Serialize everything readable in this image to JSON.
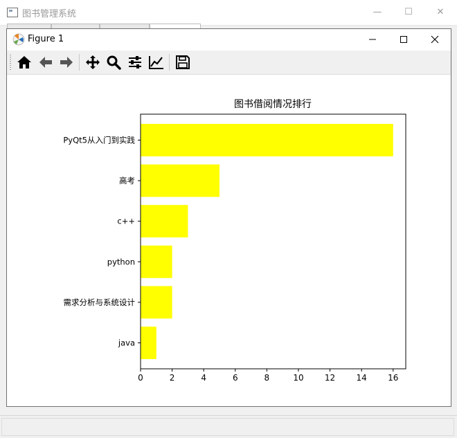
{
  "outer_window": {
    "title": "图书管理系统",
    "minimize_symbol": "—",
    "maximize_symbol": "☐",
    "close_symbol": "✕"
  },
  "figure_window": {
    "title": "Figure 1",
    "minimize_symbol": "—",
    "maximize_symbol": "☐",
    "close_symbol": "✕"
  },
  "toolbar": {
    "icons": [
      "home-icon",
      "back-arrow-icon",
      "forward-arrow-icon",
      "pan-move-icon",
      "zoom-magnifier-icon",
      "configure-subplots-icon",
      "edit-axis-icon",
      "save-floppy-icon"
    ]
  },
  "colors": {
    "bar": "#ffff00",
    "axis": "#000000",
    "background": "#ffffff"
  },
  "chart_data": {
    "type": "bar",
    "orientation": "horizontal",
    "title": "图书借阅情况排行",
    "xlabel": "",
    "ylabel": "",
    "categories": [
      "PyQt5从入门到实践",
      "高考",
      "c++",
      "python",
      "需求分析与系统设计",
      "java"
    ],
    "values": [
      16,
      5,
      3,
      2,
      2,
      1
    ],
    "xlim": [
      0,
      16.8
    ],
    "xticks": [
      0,
      2,
      4,
      6,
      8,
      10,
      12,
      14,
      16
    ],
    "grid": false
  }
}
